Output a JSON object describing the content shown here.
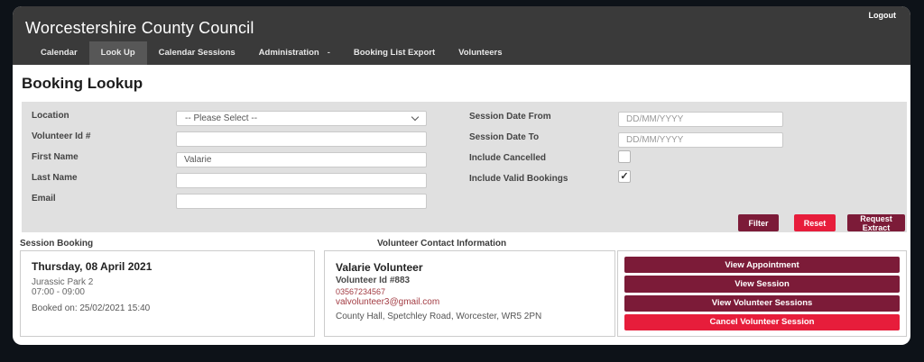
{
  "window": {
    "title": "Worcestershire County Council",
    "logout": "Logout"
  },
  "nav": {
    "dropdown_glyph": "-",
    "tabs": [
      {
        "label": "Calendar",
        "active": false,
        "dropdown": false
      },
      {
        "label": "Look Up",
        "active": true,
        "dropdown": false
      },
      {
        "label": "Calendar Sessions",
        "active": false,
        "dropdown": false
      },
      {
        "label": "Administration",
        "active": false,
        "dropdown": true
      },
      {
        "label": "Booking List Export",
        "active": false,
        "dropdown": false
      },
      {
        "label": "Volunteers",
        "active": false,
        "dropdown": false
      }
    ]
  },
  "page": {
    "heading": "Booking Lookup"
  },
  "filters": {
    "location_label": "Location",
    "location_value": "-- Please Select --",
    "volunteer_id_label": "Volunteer Id #",
    "volunteer_id_value": "",
    "first_name_label": "First Name",
    "first_name_value": "Valarie",
    "last_name_label": "Last Name",
    "last_name_value": "",
    "email_label": "Email",
    "email_value": "",
    "date_from_label": "Session Date From",
    "date_from_placeholder": "DD/MM/YYYY",
    "date_to_label": "Session Date To",
    "date_to_placeholder": "DD/MM/YYYY",
    "include_cancelled_label": "Include Cancelled",
    "include_cancelled_checked": false,
    "include_valid_label": "Include Valid Bookings",
    "include_valid_checked": true,
    "check_glyph": "✓",
    "filter_button": "Filter",
    "reset_button": "Reset",
    "request_extract_button": "Request Extract"
  },
  "booking": {
    "section_label": "Session Booking",
    "date": "Thursday, 08 April 2021",
    "venue": "Jurassic Park 2",
    "time": "07:00 - 09:00",
    "booked_on": "Booked on: 25/02/2021 15:40"
  },
  "volunteer": {
    "section_label": "Volunteer Contact Information",
    "name": "Valarie Volunteer",
    "id": "Volunteer Id #883",
    "phone": "03567234567",
    "email": "valvolunteer3@gmail.com",
    "address": "County Hall, Spetchley Road, Worcester, WR5 2PN"
  },
  "actions": [
    {
      "label": "View Appointment",
      "variant": "maroon"
    },
    {
      "label": "View Session",
      "variant": "maroon"
    },
    {
      "label": "View Volunteer Sessions",
      "variant": "maroon"
    },
    {
      "label": "Cancel Volunteer Session",
      "variant": "crimson"
    }
  ],
  "colors": {
    "frame": "#0d1218",
    "header": "#3a3a3a",
    "active_tab": "#575757",
    "panel": "#e0e0e0",
    "maroon": "#7c1b38",
    "crimson": "#e71d3b",
    "link_red": "#a23b42"
  }
}
